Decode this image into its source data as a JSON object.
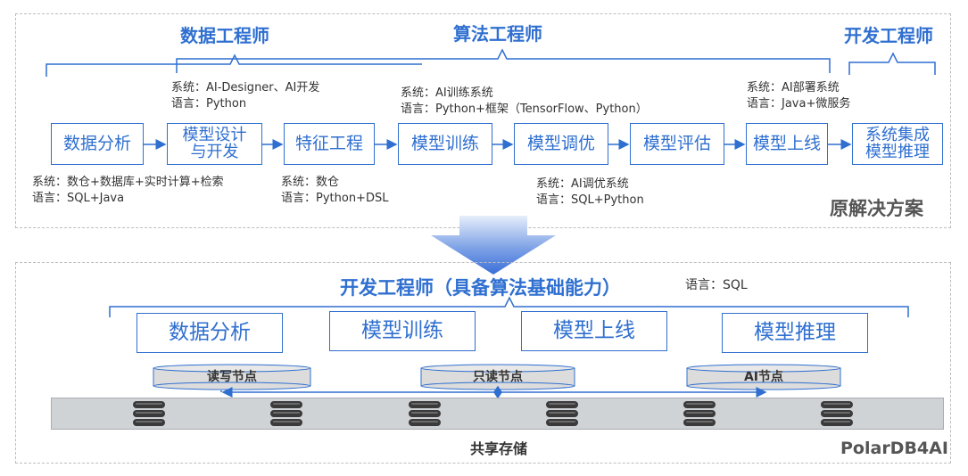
{
  "top": {
    "roles": {
      "data_engineer": "数据工程师",
      "algo_engineer": "算法工程师",
      "dev_engineer": "开发工程师"
    },
    "steps": [
      "数据分析",
      "模型设计\n与开发",
      "特征工程",
      "模型训练",
      "模型调优",
      "模型评估",
      "模型上线",
      "系统集成\n模型推理"
    ],
    "notes": {
      "design": {
        "system": "系统：AI-Designer、AI开发",
        "language": "语言：Python"
      },
      "training": {
        "system": "系统：AI训练系统",
        "language": "语言：Python+框架（TensorFlow、Python）"
      },
      "deploy": {
        "system": "系统：AI部署系统",
        "language": "语言：Java+微服务"
      },
      "analysis": {
        "system": "系统：数仓+数据库+实时计算+检索",
        "language": "语言：SQL+Java"
      },
      "feature": {
        "system": "系统：数仓",
        "language": "语言：Python+DSL"
      },
      "tuning": {
        "system": "系统：AI调优系统",
        "language": "语言：SQL+Python"
      }
    },
    "corner_label": "原解决方案"
  },
  "bottom": {
    "role": "开发工程师（具备算法基础能力）",
    "language": "语言：SQL",
    "steps": [
      "数据分析",
      "模型训练",
      "模型上线",
      "模型推理"
    ],
    "nodes": [
      "读写节点",
      "只读节点",
      "AI节点"
    ],
    "storage_label": "共享存储",
    "corner_label": "PolarDB4AI"
  },
  "colors": {
    "accent": "#2f6fd0",
    "storage_bar": "#d0d3d6",
    "node_fill": "#dcdcdc",
    "arrow": "#5b86d8"
  }
}
